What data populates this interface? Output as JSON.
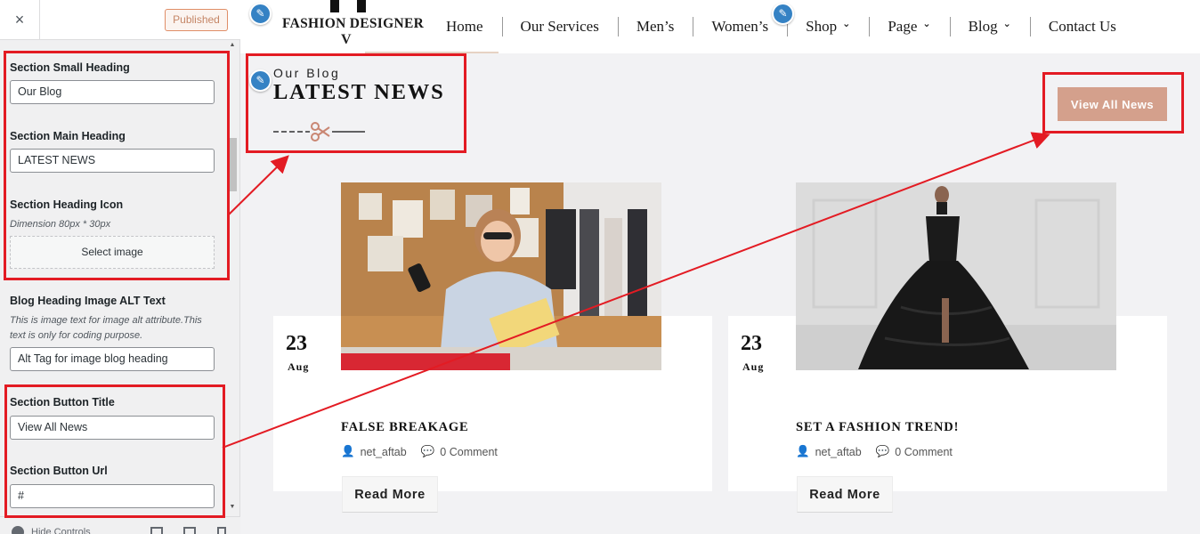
{
  "customizer": {
    "close_label": "×",
    "published_label": "Published",
    "controls": {
      "small_heading_title": "Section Small Heading",
      "small_heading_value": "Our Blog",
      "main_heading_title": "Section Main Heading",
      "main_heading_value": "LATEST NEWS",
      "heading_icon_title": "Section Heading Icon",
      "heading_icon_desc": "Dimension 80px * 30px",
      "select_image_label": "Select image",
      "alt_title": "Blog Heading Image ALT Text",
      "alt_desc": "This is image text for image alt attribute.This text is only for coding purpose.",
      "alt_value": "Alt Tag for image blog heading",
      "button_title_title": "Section Button Title",
      "button_title_value": "View All News",
      "button_url_title": "Section Button Url",
      "button_url_value": "#"
    },
    "footer": {
      "hide_controls_label": "Hide Controls"
    }
  },
  "site": {
    "logo_text": "FASHION DESIGNER",
    "logo_mark": "V",
    "nav": [
      {
        "label": "Home",
        "has_dropdown": false
      },
      {
        "label": "Our Services",
        "has_dropdown": false
      },
      {
        "label": "Men’s",
        "has_dropdown": false
      },
      {
        "label": "Women’s",
        "has_dropdown": false
      },
      {
        "label": "Shop",
        "has_dropdown": true
      },
      {
        "label": "Page",
        "has_dropdown": true
      },
      {
        "label": "Blog",
        "has_dropdown": true
      },
      {
        "label": "Contact Us",
        "has_dropdown": false
      }
    ],
    "section": {
      "small_heading": "Our Blog",
      "main_heading": "LATEST NEWS",
      "button_label": "View All News"
    },
    "posts": [
      {
        "day": "23",
        "month": "Aug",
        "title": "FALSE BREAKAGE",
        "author": "net_aftab",
        "comments": "0 Comment",
        "read_more": "Read More",
        "image": "designer-with-phone-photo"
      },
      {
        "day": "23",
        "month": "Aug",
        "title": "SET A FASHION TREND!",
        "author": "net_aftab",
        "comments": "0 Comment",
        "read_more": "Read More",
        "image": "black-gown-model-photo"
      }
    ]
  },
  "colors": {
    "accent": "#d4a08c",
    "annotation_red": "#e31b23",
    "edit_blue": "#3582c4",
    "published_border": "#e08e67"
  }
}
